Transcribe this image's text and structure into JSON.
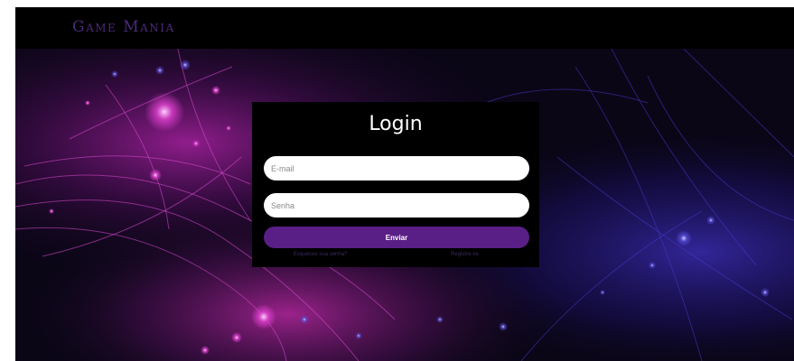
{
  "header": {
    "brand": "Game Mania"
  },
  "login": {
    "title": "Login",
    "email_placeholder": "E-mail",
    "senha_placeholder": "Senha",
    "submit_label": "Enviar",
    "forgot_link": "Esqueceu sua senha?",
    "register_link": "Registre-se"
  },
  "colors": {
    "header_bg": "#000000",
    "brand": "#4a2a78",
    "card_bg": "#000000",
    "button": "#5a1f86"
  }
}
